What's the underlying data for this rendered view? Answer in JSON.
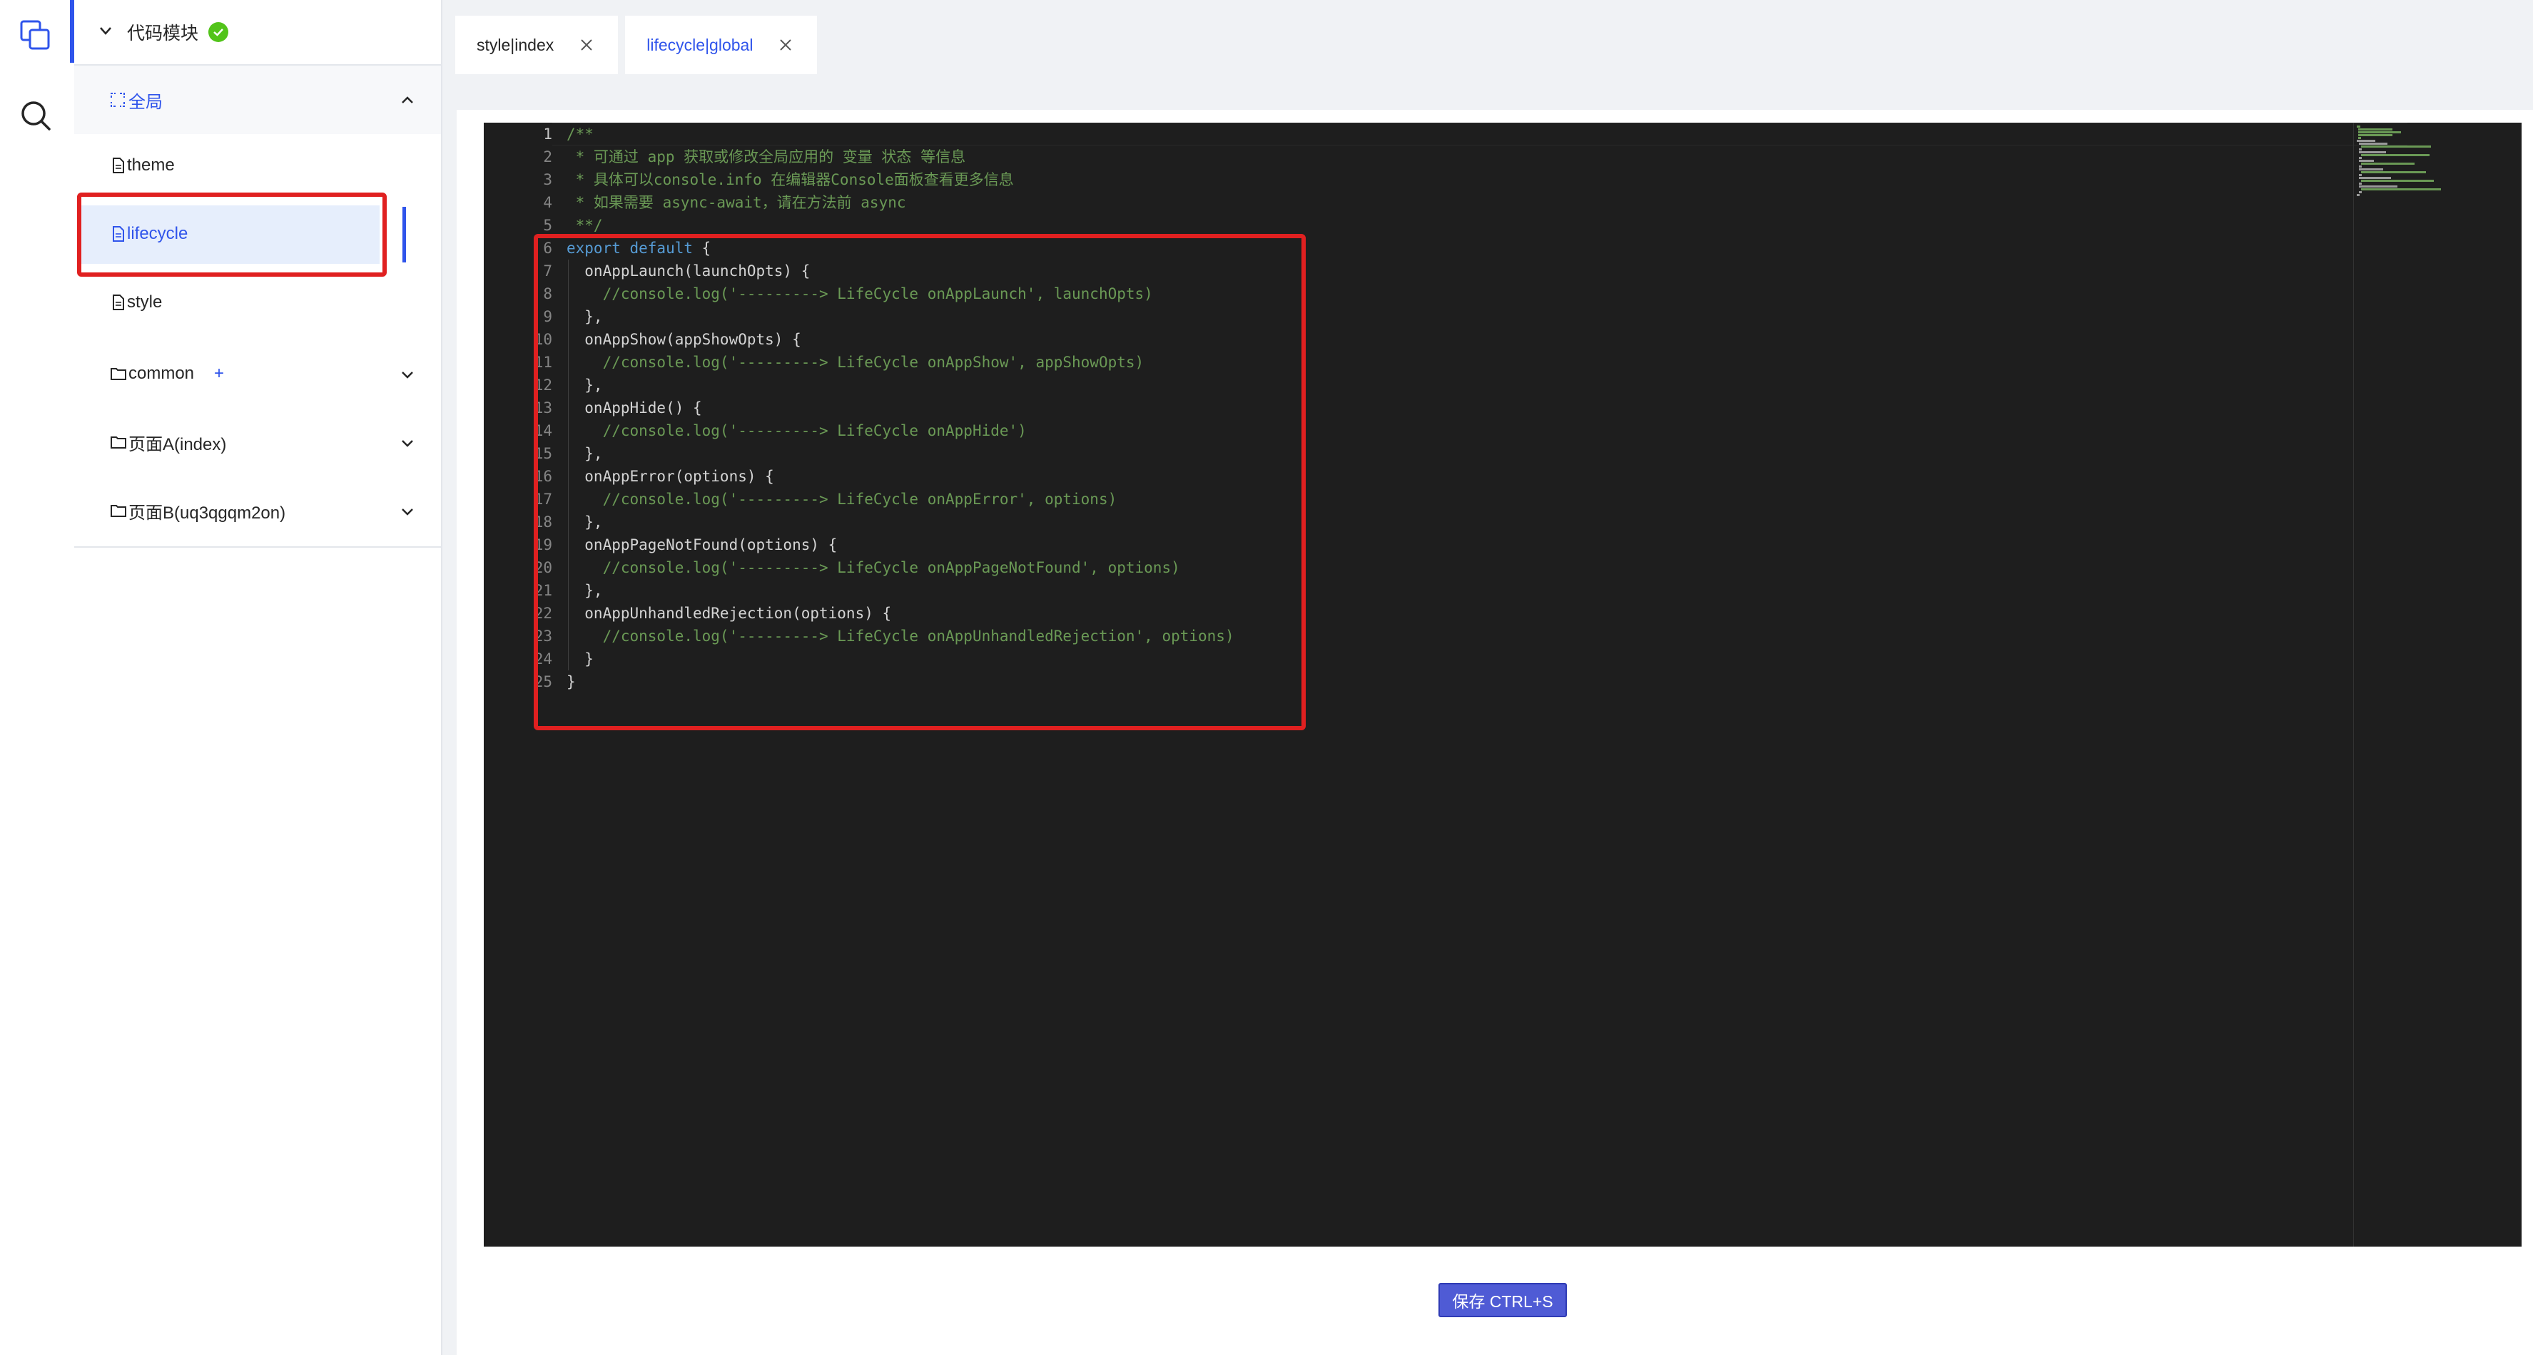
{
  "module": {
    "title": "代码模块",
    "status": "ok"
  },
  "tree": {
    "group": {
      "label": "全局",
      "expanded": true
    },
    "files": [
      {
        "label": "theme",
        "active": false
      },
      {
        "label": "lifecycle",
        "active": true
      },
      {
        "label": "style",
        "active": false
      }
    ],
    "folders": [
      {
        "label": "common",
        "has_add": true
      },
      {
        "label": "页面A(index)",
        "has_add": false
      },
      {
        "label": "页面B(uq3qgqm2on)",
        "has_add": false
      }
    ],
    "add_symbol": "+"
  },
  "tabs": [
    {
      "label": "style|index",
      "active": false
    },
    {
      "label": "lifecycle|global",
      "active": true
    }
  ],
  "editor": {
    "line_numbers": [
      "1",
      "2",
      "3",
      "4",
      "5",
      "6",
      "7",
      "8",
      "9",
      "10",
      "11",
      "12",
      "13",
      "14",
      "15",
      "16",
      "17",
      "18",
      "19",
      "20",
      "21",
      "22",
      "23",
      "24",
      "25"
    ],
    "lines": [
      "/**",
      " * 可通过 app 获取或修改全局应用的 变量 状态 等信息",
      " * 具体可以console.info 在编辑器Console面板查看更多信息",
      " * 如果需要 async-await，请在方法前 async",
      " **/",
      "export default {",
      "  onAppLaunch(launchOpts) {",
      "    //console.log('---------> LifeCycle onAppLaunch', launchOpts)",
      "  },",
      "  onAppShow(appShowOpts) {",
      "    //console.log('---------> LifeCycle onAppShow', appShowOpts)",
      "  },",
      "  onAppHide() {",
      "    //console.log('---------> LifeCycle onAppHide')",
      "  },",
      "  onAppError(options) {",
      "    //console.log('---------> LifeCycle onAppError', options)",
      "  },",
      "  onAppPageNotFound(options) {",
      "    //console.log('---------> LifeCycle onAppPageNotFound', options)",
      "  },",
      "  onAppUnhandledRejection(options) {",
      "    //console.log('---------> LifeCycle onAppUnhandledRejection', options)",
      "  }",
      "}"
    ]
  },
  "save_button": {
    "label": "保存 CTRL+S"
  },
  "colors": {
    "accent": "#2f54eb",
    "editor_bg": "#1e1e1e",
    "comment": "#6a9955",
    "keyword": "#569cd6",
    "highlight": "#e02020"
  }
}
